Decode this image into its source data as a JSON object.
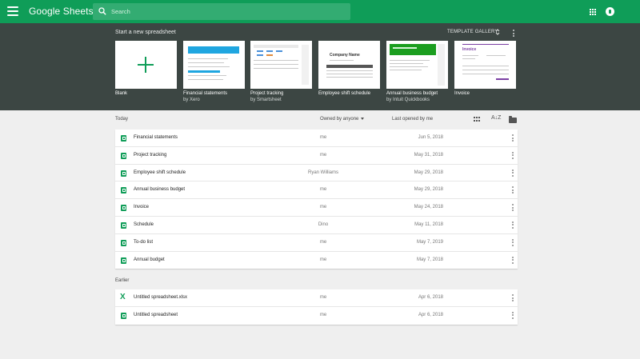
{
  "app": {
    "title": "Google Sheets"
  },
  "search": {
    "placeholder": "Search"
  },
  "templates": {
    "heading": "Start a new spreadsheet",
    "gallery_label": "TEMPLATE GALLERY",
    "items": [
      {
        "name": "Blank",
        "sub": ""
      },
      {
        "name": "Financial statements",
        "sub": "by Xero"
      },
      {
        "name": "Project tracking",
        "sub": "by Smartsheet"
      },
      {
        "name": "Employee shift schedule",
        "sub": ""
      },
      {
        "name": "Annual business budget",
        "sub": "by Intuit Quickbooks"
      },
      {
        "name": "Invoice",
        "sub": ""
      }
    ],
    "thumb_text": {
      "shift_company": "Company Name",
      "invoice_brand": "Invoice"
    }
  },
  "list_header": {
    "owned_by": "Owned by anyone",
    "last_opened": "Last opened by me",
    "sort_icon_glyph": "A↓Z"
  },
  "groups": [
    {
      "label": "Today",
      "files": [
        {
          "name": "Financial statements",
          "owner": "me",
          "date": "Jun 5, 2018",
          "type": "sheets"
        },
        {
          "name": "Project tracking",
          "owner": "me",
          "date": "May 31, 2018",
          "type": "sheets"
        },
        {
          "name": "Employee shift schedule",
          "owner": "Ryan Williams",
          "date": "May 29, 2018",
          "type": "sheets"
        },
        {
          "name": "Annual business budget",
          "owner": "me",
          "date": "May 29, 2018",
          "type": "sheets"
        },
        {
          "name": "Invoice",
          "owner": "me",
          "date": "May 24, 2018",
          "type": "sheets"
        },
        {
          "name": "Schedule",
          "owner": "Dino",
          "date": "May 11, 2018",
          "type": "sheets"
        },
        {
          "name": "To-do list",
          "owner": "me",
          "date": "May 7, 2019",
          "type": "sheets"
        },
        {
          "name": "Annual budget",
          "owner": "me",
          "date": "May 7, 2018",
          "type": "sheets"
        }
      ]
    },
    {
      "label": "Earlier",
      "files": [
        {
          "name": "Untitled spreadsheet.xlsx",
          "owner": "me",
          "date": "Apr 6, 2018",
          "type": "excel"
        },
        {
          "name": "Untitled spreadsheet",
          "owner": "me",
          "date": "Apr 6, 2018",
          "type": "sheets"
        }
      ]
    }
  ],
  "colors": {
    "brand_green": "#0f9d58",
    "template_bg": "#3c4643",
    "page_bg": "#efefef"
  }
}
